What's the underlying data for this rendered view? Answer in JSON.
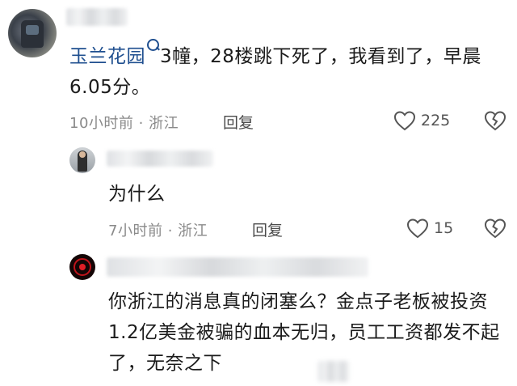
{
  "comments": [
    {
      "username": "",
      "mention": "玉兰花园",
      "text": "3幢，28楼跳下死了，我看到了，早晨6.05分。",
      "time": "10小时前",
      "separator": "·",
      "location": "浙江",
      "reply_label": "回复",
      "likes": "225"
    },
    {
      "username": "",
      "text": "为什么",
      "time": "7小时前",
      "separator": "·",
      "location": "浙江",
      "reply_label": "回复",
      "likes": "15"
    },
    {
      "username": "",
      "text": "你浙江的消息真的闭塞么？金点子老板被投资1.2亿美金被骗的血本无归，员工工资都发不起了，无奈之下"
    }
  ],
  "icons": {
    "like": "heart-outline-icon",
    "dislike": "broken-heart-icon"
  },
  "colors": {
    "mention": "#1f4f8f",
    "meta": "#8a8a8a"
  }
}
